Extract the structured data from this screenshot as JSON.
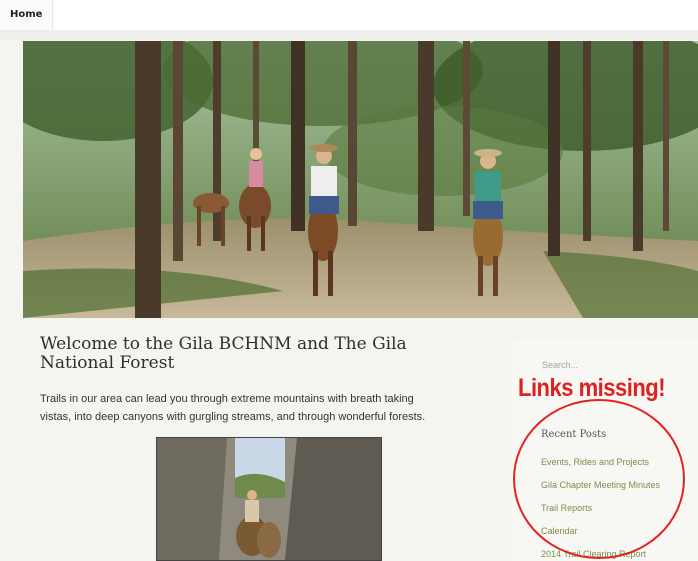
{
  "nav": {
    "items": [
      {
        "label": "Home"
      }
    ]
  },
  "main": {
    "title": "Welcome to the Gila BCHNM and The Gila National Forest",
    "intro": "Trails in our area can lead you through extreme mountains with breath taking vistas, into deep canyons with gurgling streams, and through wonderful forests."
  },
  "sidebar": {
    "search_placeholder": "Search...",
    "widget_title": "Recent Posts",
    "recent_posts": [
      "Events, Rides and Projects",
      "Gila Chapter Meeting Minutes",
      "Trail Reports",
      "Calendar",
      "2014 Trail Clearing Report"
    ]
  },
  "annotation": {
    "text": "Links missing!",
    "color": "#e02020"
  },
  "colors": {
    "link": "#7a8f4a",
    "title": "#2e2e2e"
  },
  "icons": [
    "hero-photo",
    "trail-photo"
  ]
}
